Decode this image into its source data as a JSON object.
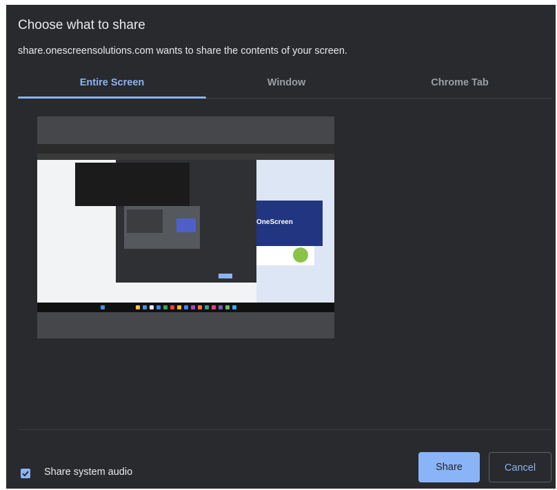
{
  "dialog": {
    "title": "Choose what to share",
    "subtitle": "share.onescreensolutions.com wants to share the contents of your screen."
  },
  "tabs": [
    {
      "label": "Entire Screen",
      "active": true
    },
    {
      "label": "Window",
      "active": false
    },
    {
      "label": "Chrome Tab",
      "active": false
    }
  ],
  "preview": {
    "brand_text": "OneScreen"
  },
  "footer": {
    "audio_checkbox_checked": true,
    "audio_label": "Share system audio",
    "share_label": "Share",
    "cancel_label": "Cancel"
  },
  "colors": {
    "dialog_bg": "#292a2d",
    "accent": "#8ab4f8",
    "text": "#e8eaed",
    "muted_text": "#9aa0a6",
    "divider": "#3c4043"
  },
  "icons": {
    "checkbox": "check-icon"
  }
}
